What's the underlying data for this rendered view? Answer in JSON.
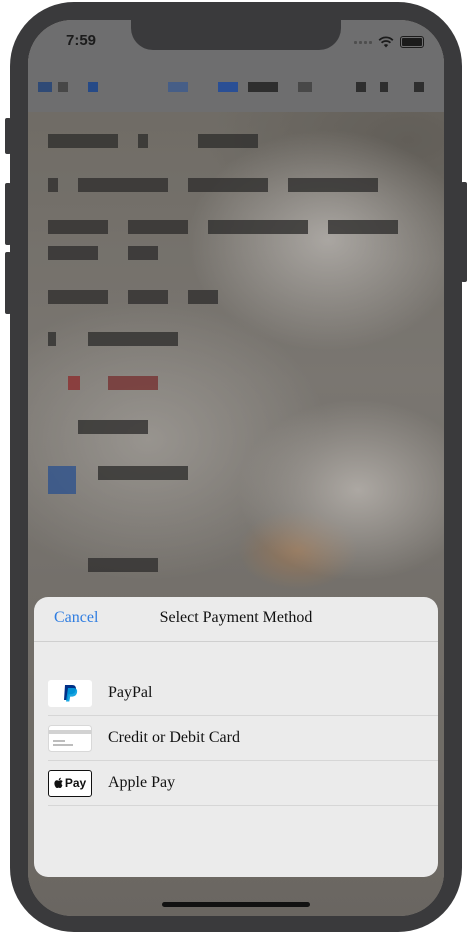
{
  "status_bar": {
    "time": "7:59"
  },
  "sheet": {
    "cancel_label": "Cancel",
    "title": "Select Payment Method",
    "methods": [
      {
        "label": "PayPal",
        "icon": "paypal-icon"
      },
      {
        "label": "Credit or Debit Card",
        "icon": "credit-card-icon"
      },
      {
        "label": "Apple Pay",
        "icon": "apple-pay-icon",
        "badge_text": "Pay"
      }
    ]
  },
  "colors": {
    "accent": "#2f7de1",
    "sheet_background": "#ebebeb",
    "device_frame": "#3a3a3c",
    "paypal_dark_blue": "#003087",
    "paypal_light_blue": "#009cde"
  }
}
